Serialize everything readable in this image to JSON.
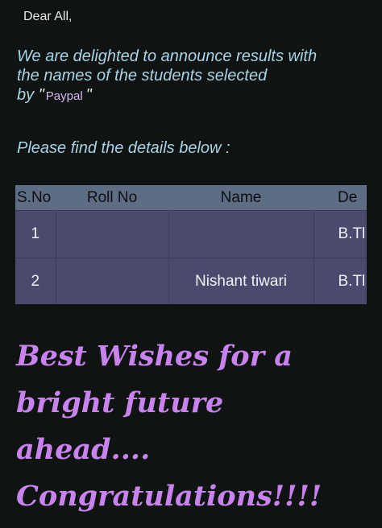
{
  "greeting": "Dear All,",
  "intro": {
    "line1": "We are delighted to announce results with",
    "line2": "the names of the students selected",
    "line3_prefix": "by",
    "open_quote": "\"",
    "company": "Paypal",
    "close_quote": "\""
  },
  "details_text": "Please find the details below :",
  "table": {
    "headers": [
      "S.No",
      "Roll No",
      "Name",
      "De"
    ],
    "rows": [
      [
        "1",
        "",
        "",
        "B.Tl"
      ],
      [
        "2",
        "",
        "Nishant tiwari",
        "B.Tl"
      ]
    ]
  },
  "wishes": {
    "line1": "Best Wishes for a",
    "line2": "bright future",
    "line3": "ahead....",
    "line4": "Congratulations!!!!"
  },
  "colors": {
    "background": "#0f1413",
    "intro_text": "#a9d3e6",
    "table_header": "#5d6e84",
    "table_row": "#4a4a6e",
    "wishes_text": "#c983ee"
  }
}
